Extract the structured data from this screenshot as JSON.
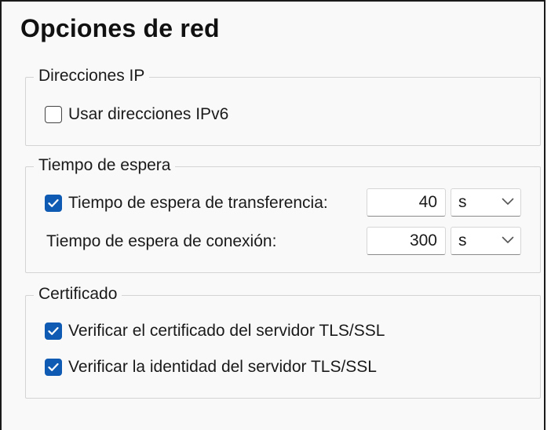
{
  "page": {
    "title": "Opciones de red"
  },
  "ip_group": {
    "legend": "Direcciones IP",
    "use_ipv6": {
      "label": "Usar direcciones IPv6",
      "checked": false
    }
  },
  "timeout_group": {
    "legend": "Tiempo de espera",
    "transfer": {
      "label": "Tiempo de espera de transferencia:",
      "checked": true,
      "value": "40",
      "unit": "s"
    },
    "connection": {
      "label": "Tiempo de espera de conexión:",
      "value": "300",
      "unit": "s"
    }
  },
  "cert_group": {
    "legend": "Certificado",
    "verify_cert": {
      "label": "Verificar el certificado del servidor TLS/SSL",
      "checked": true
    },
    "verify_identity": {
      "label": "Verificar la identidad del servidor TLS/SSL",
      "checked": true
    }
  },
  "icons": {
    "checkbox_checked": "check-icon",
    "dropdown": "chevron-down-icon"
  },
  "colors": {
    "accent": "#0f5bb3",
    "background": "#f9f9f9",
    "group_border": "#d4d4d4"
  }
}
